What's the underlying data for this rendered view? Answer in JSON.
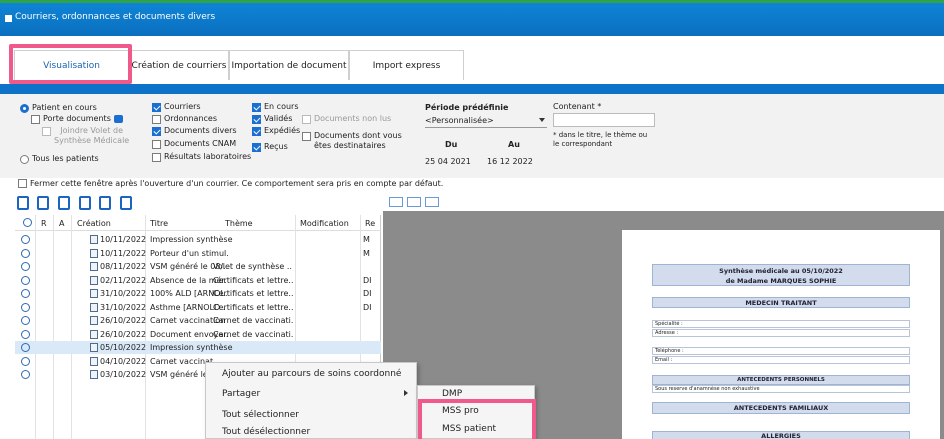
{
  "window": {
    "title": "Courriers, ordonnances et documents divers"
  },
  "tabs": [
    {
      "label": "Visualisation",
      "active": true
    },
    {
      "label": "Création de courriers",
      "active": false
    },
    {
      "label": "Importation de document",
      "active": false
    },
    {
      "label": "Import express",
      "active": false
    }
  ],
  "filters": {
    "patient_en_cours": "Patient en cours",
    "porte_documents": "Porte documents",
    "joindre_volet_1": "Joindre Volet de",
    "joindre_volet_2": "Synthèse Médicale",
    "tous_les_patients": "Tous les patients",
    "courriers": "Courriers",
    "ordonnances": "Ordonnances",
    "documents_divers": "Documents divers",
    "documents_cnam": "Documents CNAM",
    "resultats_laboratoires": "Résultats laboratoires",
    "en_cours": "En cours",
    "valides": "Validés",
    "expedies": "Expédiés",
    "recus": "Reçus",
    "documents_non_lus": "Documents non lus",
    "documents_dont_vous_1": "Documents dont vous",
    "documents_dont_vous_2": "êtes destinataires",
    "periode_label": "Période prédéfinie",
    "periode_value": "<Personnalisée>",
    "du_label": "Du",
    "au_label": "Au",
    "du_value": "25  04   2021",
    "au_value": "16  12   2022",
    "contenant_label": "Contenant *",
    "contenant_note_1": "* dans le titre, le thème     ou",
    "contenant_note_2": "le correspondant"
  },
  "close_option": "Fermer cette fenêtre après l'ouverture d'un courrier. Ce comportement sera pris en compte par défaut.",
  "grid": {
    "headers": {
      "r": "R",
      "a": "A",
      "creation": "Création",
      "titre": "Titre",
      "theme": "Thème",
      "modification": "Modification",
      "re": "Re"
    },
    "rows": [
      {
        "date": "10/11/2022",
        "title": "Impression synthèse",
        "theme": "",
        "r": "M"
      },
      {
        "date": "10/11/2022",
        "title": "Porteur d'un stimul.",
        "theme": "",
        "r": "M"
      },
      {
        "date": "08/11/2022",
        "title": "VSM généré le 08/.",
        "theme": "Volet de synthèse ..",
        "r": ""
      },
      {
        "date": "02/11/2022",
        "title": "Absence de la mér.",
        "theme": "Certificats et lettre..",
        "r": "DI"
      },
      {
        "date": "31/10/2022",
        "title": "100% ALD [ARNOL.",
        "theme": "Certificats et lettre..",
        "r": "DI"
      },
      {
        "date": "31/10/2022",
        "title": "Asthme [ARNOLD .",
        "theme": "Certificats et lettre..",
        "r": "DI"
      },
      {
        "date": "26/10/2022",
        "title": "Carnet vaccination",
        "theme": "Carnet de vaccinati.",
        "r": ""
      },
      {
        "date": "26/10/2022",
        "title": "Document envoyer.",
        "theme": "Carnet de vaccinati.",
        "r": ""
      },
      {
        "date": "05/10/2022",
        "title": "Impression synthèse",
        "theme": "",
        "r": ""
      },
      {
        "date": "04/10/2022",
        "title": "Carnet vaccinat",
        "theme": "",
        "r": ""
      },
      {
        "date": "03/10/2022",
        "title": "VSM généré le 0",
        "theme": "",
        "r": ""
      }
    ]
  },
  "preview": {
    "title_1": "Synthèse médicale au 05/10/2022",
    "title_2": "de Madame MARQUES SOPHIE",
    "medecin": "MEDECIN TRAITANT",
    "specialite": "Spécialité :",
    "adresse": "Adresse :",
    "telephone": "Téléphone :",
    "email": "Email :",
    "antecedents_perso": "ANTECEDENTS PERSONNELS",
    "antecedent_line": "Sous reserve d'anamnèse non exhaustive",
    "antecedents_fam": "ANTECEDENTS FAMILIAUX",
    "allergies": "ALLERGIES"
  },
  "context_menu": {
    "ajouter": "Ajouter au parcours de soins coordonné",
    "partager": "Partager",
    "tout_selectionner": "Tout sélectionner",
    "tout_deselectionner": "Tout désélectionner"
  },
  "submenu": {
    "dmp": "DMP",
    "mss_pro": "MSS pro",
    "mss_patient": "MSS patient"
  },
  "colors": {
    "accent": "#0d73c8",
    "highlight": "#ef5a8a"
  }
}
